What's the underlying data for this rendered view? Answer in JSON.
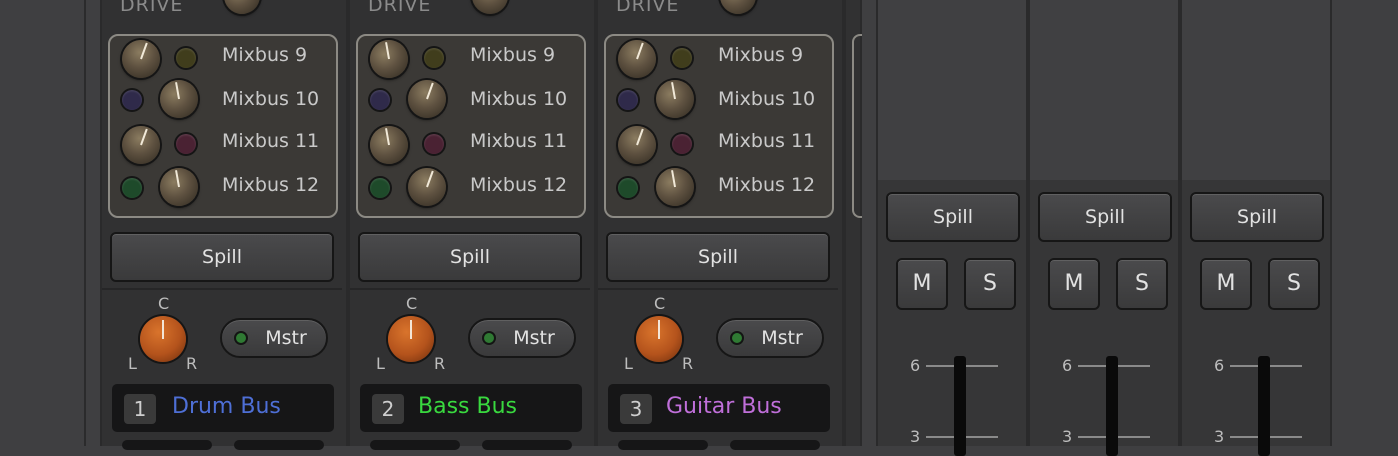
{
  "colors": {
    "drum_bus": "#4e6fd6",
    "bass_bus": "#39d93f",
    "guitar_bus": "#c06fda",
    "pan_knob": "#c45f23"
  },
  "bus_strips": [
    {
      "section_label": "DRIVE",
      "sends": [
        "Mixbus 9",
        "Mixbus 10",
        "Mixbus 11",
        "Mixbus 12"
      ],
      "spill_label": "Spill",
      "pan": {
        "center": "C",
        "left": "L",
        "right": "R"
      },
      "mstr_label": "Mstr",
      "number": "1",
      "name": "Drum Bus"
    },
    {
      "section_label": "DRIVE",
      "sends": [
        "Mixbus 9",
        "Mixbus 10",
        "Mixbus 11",
        "Mixbus 12"
      ],
      "spill_label": "Spill",
      "pan": {
        "center": "C",
        "left": "L",
        "right": "R"
      },
      "mstr_label": "Mstr",
      "number": "2",
      "name": "Bass Bus"
    },
    {
      "section_label": "DRIVE",
      "sends": [
        "Mixbus 9",
        "Mixbus 10",
        "Mixbus 11",
        "Mixbus 12"
      ],
      "spill_label": "Spill",
      "pan": {
        "center": "C",
        "left": "L",
        "right": "R"
      },
      "mstr_label": "Mstr",
      "number": "3",
      "name": "Guitar Bus"
    }
  ],
  "mixbus_strips": [
    {
      "spill_label": "Spill",
      "mute_label": "M",
      "solo_label": "S",
      "scale": [
        "6",
        "3"
      ]
    },
    {
      "spill_label": "Spill",
      "mute_label": "M",
      "solo_label": "S",
      "scale": [
        "6",
        "3"
      ]
    },
    {
      "spill_label": "Spill",
      "mute_label": "M",
      "solo_label": "S",
      "scale": [
        "6",
        "3"
      ]
    }
  ]
}
